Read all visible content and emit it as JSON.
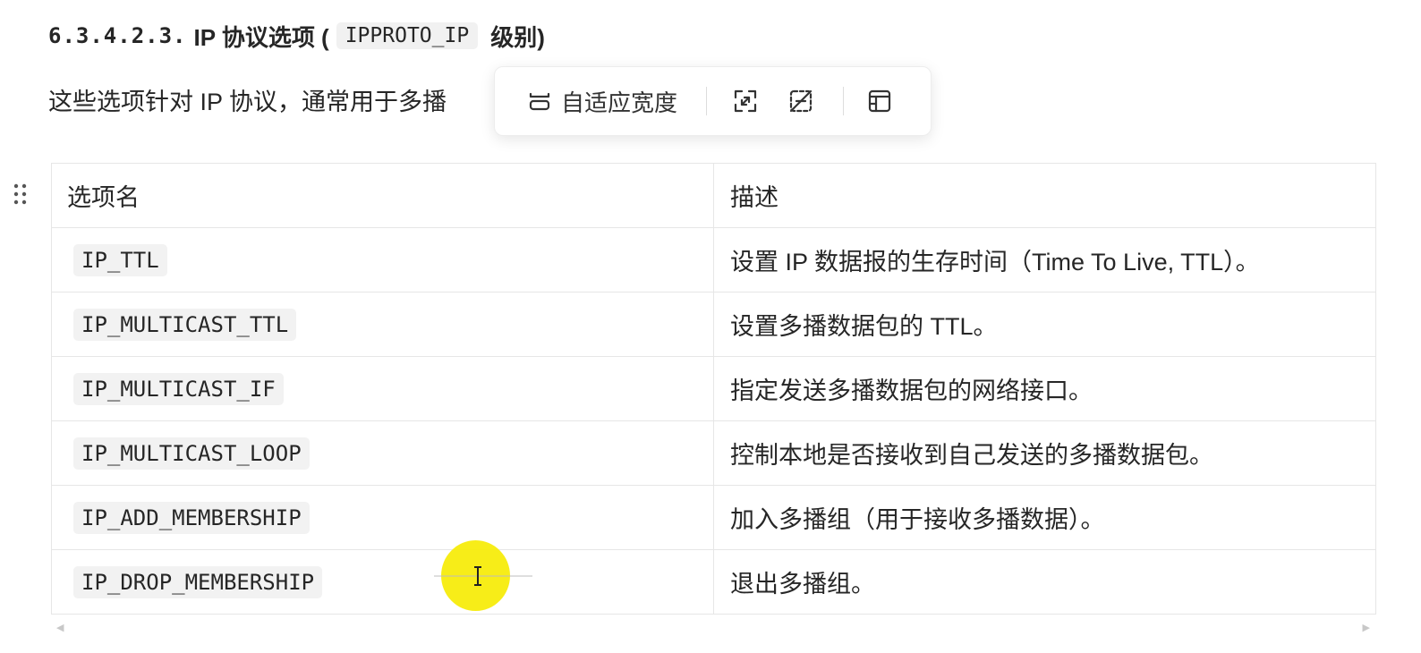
{
  "heading": {
    "number": "6.3.4.2.3.",
    "text_before": "IP 协议选项 (",
    "code": "IPPROTO_IP",
    "text_after": "级别)"
  },
  "paragraph": "这些选项针对 IP 协议，通常用于多播",
  "toolbar": {
    "fit_width_label": "自适应宽度",
    "icons": [
      "fit-width-icon",
      "fullscreen-icon",
      "no-border-icon",
      "table-layout-icon"
    ]
  },
  "table": {
    "headers": [
      "选项名",
      "描述"
    ],
    "rows": [
      {
        "option": "IP_TTL",
        "desc": "设置 IP 数据报的生存时间（Time To Live, TTL）。"
      },
      {
        "option": "IP_MULTICAST_TTL",
        "desc": "设置多播数据包的 TTL。"
      },
      {
        "option": "IP_MULTICAST_IF",
        "desc": "指定发送多播数据包的网络接口。"
      },
      {
        "option": "IP_MULTICAST_LOOP",
        "desc": "控制本地是否接收到自己发送的多播数据包。"
      },
      {
        "option": "IP_ADD_MEMBERSHIP",
        "desc": "加入多播组（用于接收多播数据）。"
      },
      {
        "option": "IP_DROP_MEMBERSHIP",
        "desc": "退出多播组。"
      }
    ]
  },
  "colors": {
    "text": "#262626",
    "border": "#e6e6e6",
    "code_bg": "#f2f2f2",
    "cursor_highlight": "#f7ec0c"
  }
}
